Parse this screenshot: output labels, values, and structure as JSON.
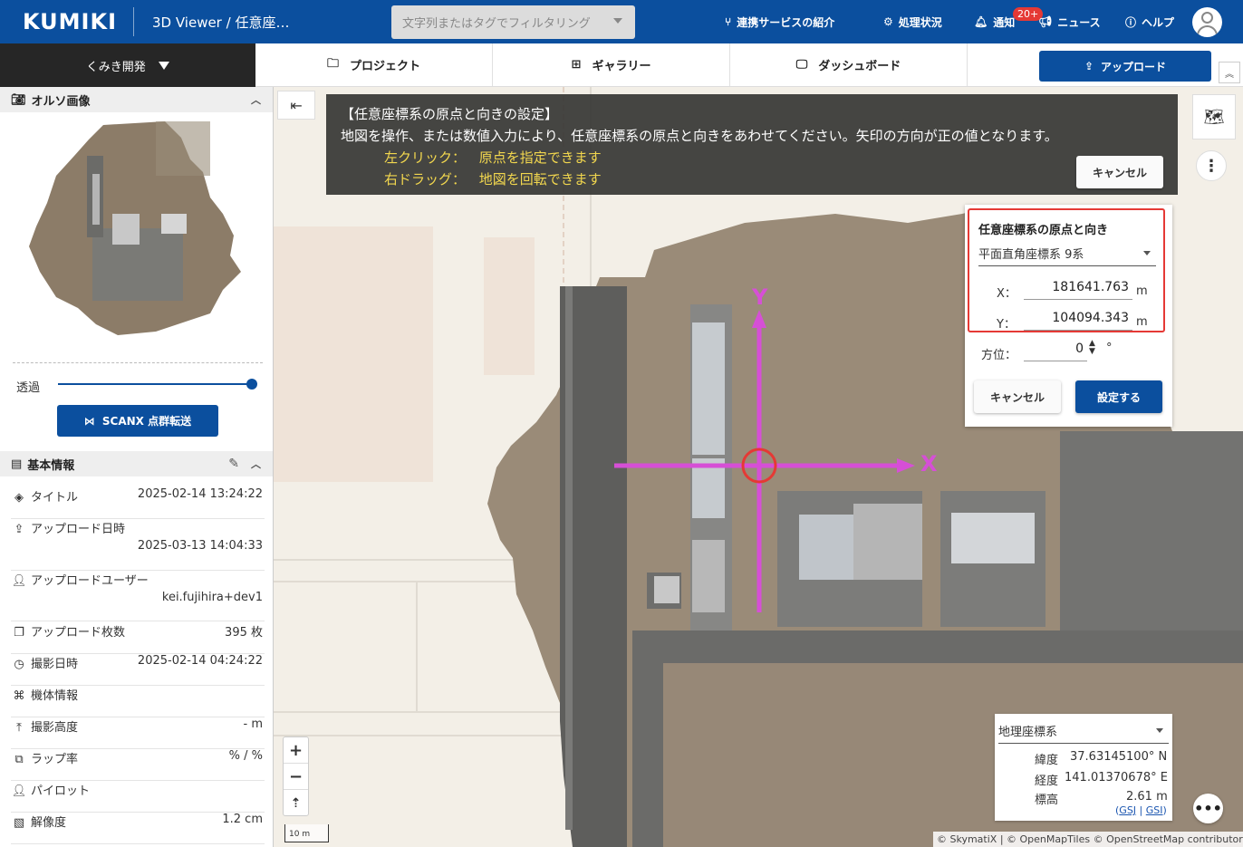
{
  "header": {
    "logo": "KUMIKI",
    "viewer_title": "3D Viewer / 任意座…",
    "filter_placeholder": "文字列またはタグでフィルタリング",
    "nav": {
      "services": "連携サービスの紹介",
      "processing": "処理状況",
      "notifications": "通知",
      "notifications_badge": "20+",
      "news": "ニュース",
      "help": "ヘルプ"
    }
  },
  "subbar": {
    "project_select": "くみき開発",
    "tabs": [
      "プロジェクト",
      "ギャラリー",
      "ダッシュボード"
    ],
    "upload": "アップロード"
  },
  "sidebar": {
    "ortho_title": "オルソ画像",
    "opacity_label": "透過",
    "opacity_value": 1.0,
    "scanx_button": "SCANX 点群転送",
    "basic_title": "基本情報",
    "info": [
      {
        "icon": "layers-icon",
        "label": "タイトル",
        "value": "2025-02-14 13:24:22"
      },
      {
        "icon": "upload-icon",
        "label": "アップロード日時",
        "value": "2025-03-13 14:04:33"
      },
      {
        "icon": "user-icon",
        "label": "アップロードユーザー",
        "value": "kei.fujihira+dev1"
      },
      {
        "icon": "images-icon",
        "label": "アップロード枚数",
        "value": "395 枚"
      },
      {
        "icon": "clock-icon",
        "label": "撮影日時",
        "value": "2025-02-14 04:24:22"
      },
      {
        "icon": "drone-icon",
        "label": "機体情報",
        "value": ""
      },
      {
        "icon": "altitude-icon",
        "label": "撮影高度",
        "value": "- m"
      },
      {
        "icon": "overlap-icon",
        "label": "ラップ率",
        "value": "% / %"
      },
      {
        "icon": "pilot-icon",
        "label": "パイロット",
        "value": ""
      },
      {
        "icon": "image-icon",
        "label": "解像度",
        "value": "1.2 cm"
      }
    ]
  },
  "banner": {
    "title": "【任意座標系の原点と向きの設定】",
    "description": "地図を操作、または数値入力により、任意座標系の原点と向きをあわせてください。矢印の方向が正の値となります。",
    "left_click_key": "左クリック：",
    "left_click_desc": "原点を指定できます",
    "right_drag_key": "右ドラッグ：",
    "right_drag_desc": "地図を回転できます",
    "cancel": "キャンセル"
  },
  "coord_panel": {
    "title": "任意座標系の原点と向き",
    "system": "平面直角座標系 9系",
    "x_label": "X：",
    "x_value": "181641.763",
    "y_label": "Y：",
    "y_value": "104094.343",
    "unit": "m",
    "bearing_label": "方位：",
    "bearing_value": "0",
    "bearing_unit": "°",
    "cancel": "キャンセル",
    "apply": "設定する"
  },
  "map": {
    "axis_x": "X",
    "axis_y": "Y",
    "axis_color": "#d64fd6",
    "origin_color": "#e53935"
  },
  "geo": {
    "system": "地理座標系",
    "lat_label": "緯度",
    "lat_value": "37.63145100° N",
    "lon_label": "経度",
    "lon_value": "141.01370678° E",
    "alt_label": "標高",
    "alt_value": "2.61 m",
    "link1": "GSJ",
    "link2": "GSI"
  },
  "scale_label": "10 m",
  "attribution": "© SkymatiX | © OpenMapTiles © OpenStreetMap contributors"
}
